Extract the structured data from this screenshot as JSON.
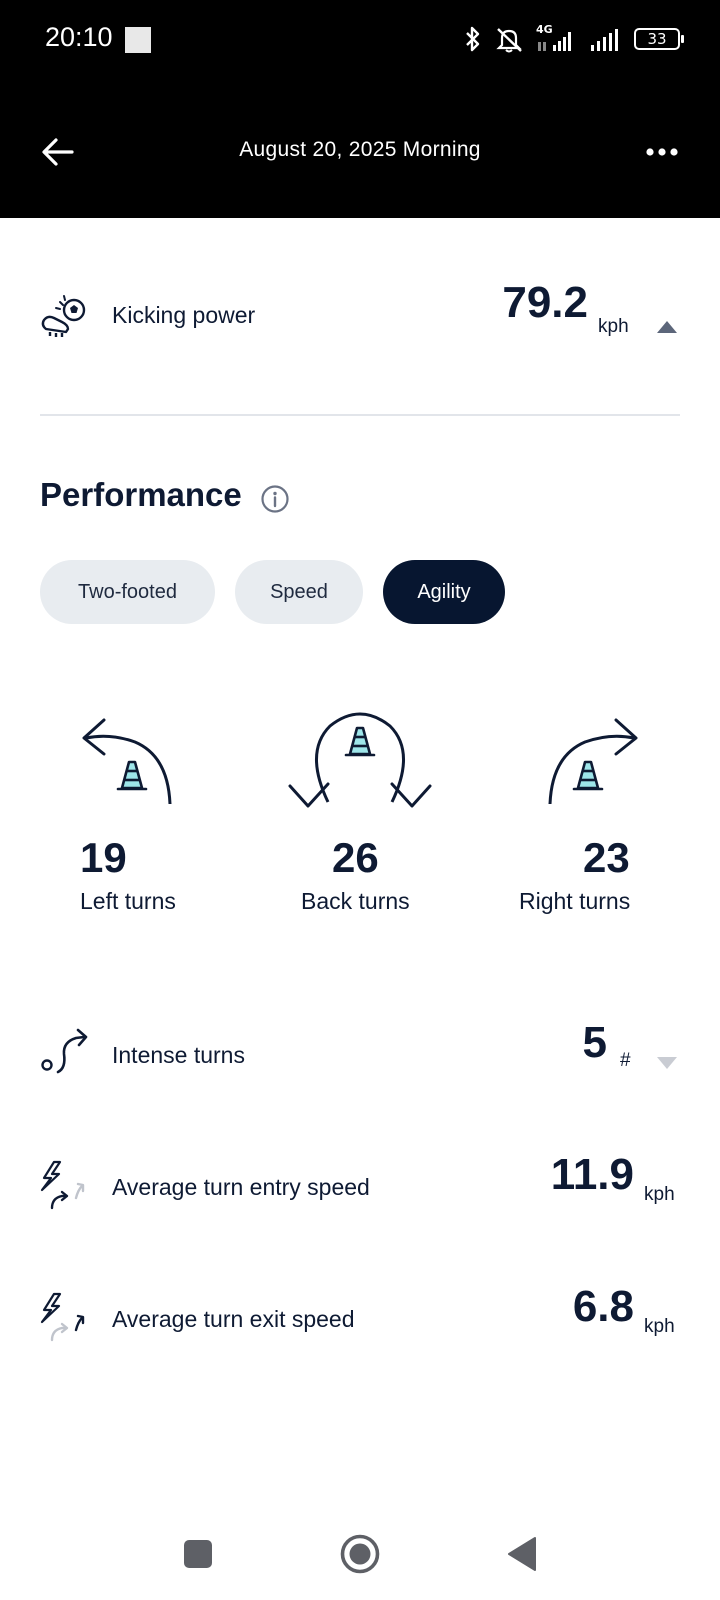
{
  "status_bar": {
    "time": "20:10",
    "network": "4G",
    "battery": "33"
  },
  "header": {
    "title": "August 20, 2025 Morning"
  },
  "kicking_power": {
    "label": "Kicking power",
    "value": "79.2",
    "unit": "kph"
  },
  "performance": {
    "title": "Performance",
    "tabs": [
      {
        "label": "Two-footed",
        "active": false
      },
      {
        "label": "Speed",
        "active": false
      },
      {
        "label": "Agility",
        "active": true
      }
    ],
    "turns": [
      {
        "value": "19",
        "label": "Left turns"
      },
      {
        "value": "26",
        "label": "Back turns"
      },
      {
        "value": "23",
        "label": "Right turns"
      }
    ],
    "metrics": [
      {
        "label": "Intense turns",
        "value": "5",
        "unit": "#"
      },
      {
        "label": "Average turn entry speed",
        "value": "11.9",
        "unit": "kph"
      },
      {
        "label": "Average turn exit speed",
        "value": "6.8",
        "unit": "kph"
      }
    ]
  },
  "colors": {
    "primary": "#0e1a33",
    "cone": "#9ee6ea",
    "pill_bg": "#e8ecf0",
    "pill_active": "#071630"
  }
}
